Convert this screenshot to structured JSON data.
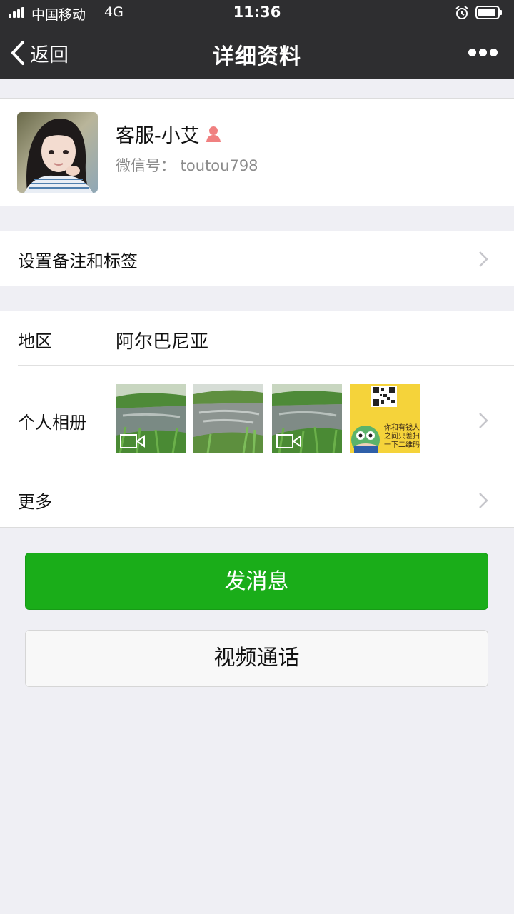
{
  "status_bar": {
    "carrier": "中国移动",
    "network": "4G",
    "time": "11:36",
    "icons": [
      "signal-icon",
      "alarm-icon",
      "battery-icon"
    ]
  },
  "nav": {
    "back_label": "返回",
    "title": "详细资料",
    "more_icon": "more-icon"
  },
  "profile": {
    "name": "客服-小艾",
    "gender_icon": "female-icon",
    "wechat_id": "微信号： toutou798"
  },
  "remark": {
    "label": "设置备注和标签"
  },
  "info": {
    "region_label": "地区",
    "region_value": "阿尔巴尼亚",
    "album_label": "个人相册",
    "album_items": [
      "video",
      "photo",
      "video",
      "qr-poster"
    ],
    "poster_text": [
      "你和有钱人",
      "之间只差扫",
      "一下二维码"
    ],
    "more_label": "更多"
  },
  "buttons": {
    "send_message": "发消息",
    "video_call": "视频通话"
  },
  "colors": {
    "nav_bg": "#2e2e30",
    "page_bg": "#efeff4",
    "primary": "#1aad19",
    "female_icon": "#f08080"
  }
}
